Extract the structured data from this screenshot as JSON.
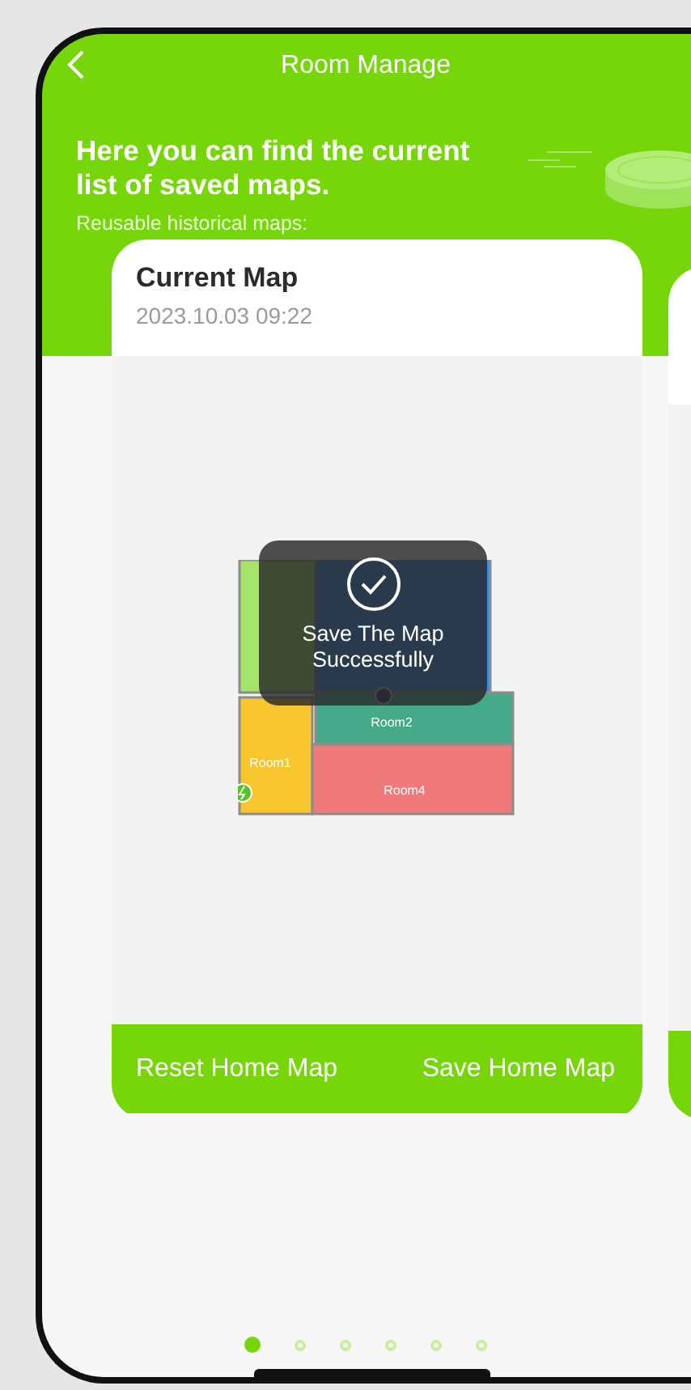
{
  "nav": {
    "title": "Room Manage"
  },
  "intro": {
    "headline": "Here you can find the current list of saved maps.",
    "subtitle": "Reusable historical maps:"
  },
  "cards": [
    {
      "title": "Current Map",
      "date": "2023.10.03 09:22",
      "rooms": [
        {
          "color": "#a6e36a"
        },
        {
          "color": "#2e8bef"
        },
        {
          "name": "Room2",
          "color": "#45a98a"
        },
        {
          "name": "Room1",
          "color": "#f7c62f"
        },
        {
          "name": "Room4",
          "color": "#f07a7a"
        }
      ],
      "toast": "Save The Map Successfully",
      "buttons": [
        "Reset Home Map",
        "Save Home Map"
      ]
    }
  ],
  "pages": [
    {
      "selected": true
    },
    {
      "selected": false
    },
    {
      "selected": false
    },
    {
      "selected": false
    },
    {
      "selected": false
    },
    {
      "selected": false
    }
  ]
}
